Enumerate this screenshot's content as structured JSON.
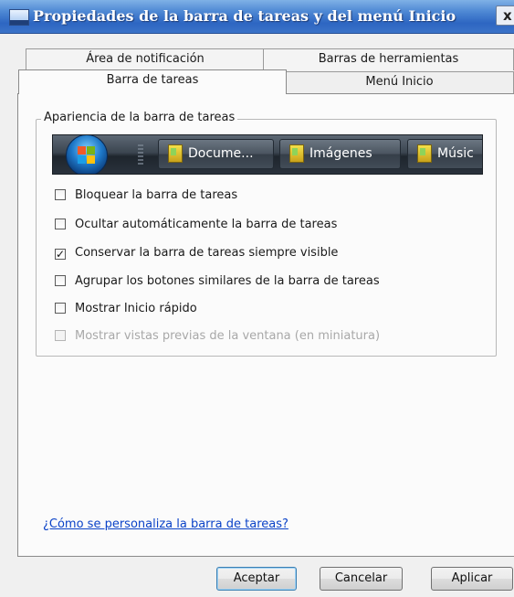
{
  "window": {
    "title": "Propiedades de la barra de tareas y del menú Inicio",
    "close_glyph": "x"
  },
  "tabs": {
    "back_row": [
      "Área de notificación",
      "Barras de herramientas"
    ],
    "front_row": [
      "Barra de tareas",
      "Menú Inicio"
    ],
    "selected": "Barra de tareas"
  },
  "appearance_group": {
    "label": "Apariencia de la barra de tareas",
    "taskbar_preview": {
      "start_icon": "windows-orb-icon",
      "buttons": [
        "Docume...",
        "Imágenes",
        "Músic"
      ]
    },
    "options": [
      {
        "label": "Bloquear la barra de tareas",
        "checked": false,
        "enabled": true
      },
      {
        "label": "Ocultar automáticamente la barra de tareas",
        "checked": false,
        "enabled": true
      },
      {
        "label": "Conservar la barra de tareas siempre visible",
        "checked": true,
        "enabled": true
      },
      {
        "label": "Agrupar los botones similares de la barra de tareas",
        "checked": false,
        "enabled": true
      },
      {
        "label": "Mostrar Inicio rápido",
        "checked": false,
        "enabled": true
      },
      {
        "label": "Mostrar vistas previas de la ventana (en miniatura)",
        "checked": false,
        "enabled": false
      }
    ]
  },
  "help_link": "¿Cómo se personaliza la barra de tareas?",
  "buttons": {
    "ok": "Aceptar",
    "cancel": "Cancelar",
    "apply": "Aplicar"
  },
  "colors": {
    "titlebar": "#2d66c2",
    "link": "#0b43c8",
    "disabled_text": "#a8a8a8"
  }
}
